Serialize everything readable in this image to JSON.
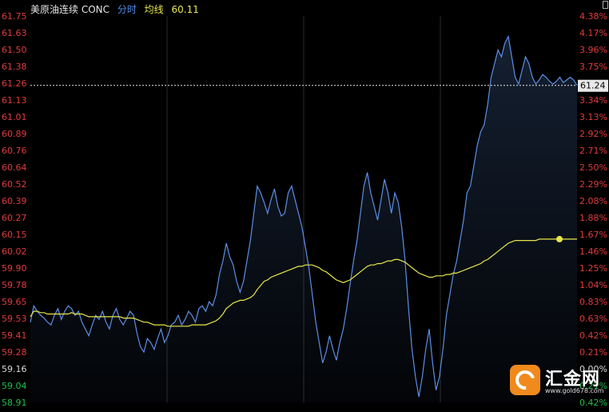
{
  "header": {
    "instrument": "美原油连续 CONC",
    "mode": "分时",
    "avg_label": "均线",
    "avg_value": "60.11"
  },
  "last_price_label": "61.24",
  "watermark": {
    "title": "汇金网",
    "subtitle": "www.gold678.com"
  },
  "colors": {
    "price_line": "#5b8fe6",
    "avg_line": "#e8e84a",
    "up": "#e23b3b",
    "down": "#1fbf4a",
    "grid": "#2a2a2a"
  },
  "chart_data": {
    "type": "line",
    "title": "",
    "xlabel": "",
    "ylabel": "",
    "ylim": [
      58.91,
      61.75
    ],
    "prev_close": 59.16,
    "y_ticks_left": [
      "61.75",
      "61.63",
      "61.50",
      "61.38",
      "61.26",
      "61.13",
      "61.01",
      "60.89",
      "60.76",
      "60.64",
      "60.52",
      "60.39",
      "60.27",
      "60.15",
      "60.02",
      "59.90",
      "59.78",
      "59.65",
      "59.53",
      "59.41",
      "59.28",
      "59.16",
      "59.04",
      "58.91"
    ],
    "y_ticks_right": [
      "4.38%",
      "4.17%",
      "3.96%",
      "3.75%",
      "3.54%",
      "3.34%",
      "3.13%",
      "2.92%",
      "2.71%",
      "2.50%",
      "2.29%",
      "2.08%",
      "1.88%",
      "1.67%",
      "1.46%",
      "1.25%",
      "1.04%",
      "0.83%",
      "0.63%",
      "0.42%",
      "0.21%",
      "0.00%",
      "0.21%",
      "0.42%"
    ],
    "reference_line": 61.24,
    "series": [
      {
        "values": [
          59.5,
          59.62,
          59.58,
          59.55,
          59.53,
          59.5,
          59.48,
          59.55,
          59.6,
          59.52,
          59.58,
          59.62,
          59.6,
          59.55,
          59.58,
          59.5,
          59.45,
          59.4,
          59.48,
          59.55,
          59.52,
          59.58,
          59.5,
          59.45,
          59.55,
          59.6,
          59.52,
          59.48,
          59.53,
          59.58,
          59.55,
          59.42,
          59.32,
          59.28,
          59.38,
          59.35,
          59.3,
          59.38,
          59.45,
          59.35,
          59.4,
          59.48,
          59.5,
          59.55,
          59.48,
          59.52,
          59.58,
          59.55,
          59.5,
          59.6,
          59.62,
          59.58,
          59.65,
          59.62,
          59.7,
          59.85,
          59.95,
          60.08,
          59.98,
          59.92,
          59.8,
          59.72,
          59.8,
          59.95,
          60.1,
          60.3,
          60.5,
          60.45,
          60.38,
          60.3,
          60.4,
          60.48,
          60.35,
          60.28,
          60.3,
          60.45,
          60.5,
          60.4,
          60.3,
          60.2,
          60.05,
          59.9,
          59.7,
          59.5,
          59.35,
          59.2,
          59.28,
          59.4,
          59.3,
          59.22,
          59.35,
          59.45,
          59.6,
          59.78,
          59.95,
          60.1,
          60.3,
          60.5,
          60.6,
          60.45,
          60.35,
          60.25,
          60.4,
          60.55,
          60.45,
          60.3,
          60.45,
          60.38,
          60.2,
          59.95,
          59.6,
          59.3,
          59.1,
          58.95,
          59.1,
          59.3,
          59.45,
          59.2,
          59.0,
          59.1,
          59.3,
          59.55,
          59.7,
          59.85,
          59.95,
          60.1,
          60.25,
          60.45,
          60.5,
          60.65,
          60.8,
          60.9,
          60.95,
          61.1,
          61.3,
          61.4,
          61.5,
          61.45,
          61.55,
          61.6,
          61.45,
          61.3,
          61.25,
          61.35,
          61.45,
          61.4,
          61.3,
          61.25,
          61.28,
          61.32,
          61.3,
          61.27,
          61.25,
          61.27,
          61.3,
          61.26,
          61.28,
          61.3,
          61.28,
          61.24
        ]
      },
      {
        "values": [
          59.54,
          59.58,
          59.58,
          59.57,
          59.57,
          59.56,
          59.56,
          59.56,
          59.56,
          59.56,
          59.56,
          59.56,
          59.57,
          59.56,
          59.56,
          59.56,
          59.55,
          59.54,
          59.54,
          59.54,
          59.54,
          59.54,
          59.54,
          59.54,
          59.54,
          59.54,
          59.54,
          59.53,
          59.53,
          59.53,
          59.53,
          59.52,
          59.51,
          59.5,
          59.5,
          59.49,
          59.48,
          59.48,
          59.48,
          59.48,
          59.47,
          59.47,
          59.47,
          59.47,
          59.47,
          59.47,
          59.47,
          59.48,
          59.48,
          59.48,
          59.48,
          59.48,
          59.49,
          59.5,
          59.51,
          59.53,
          59.56,
          59.6,
          59.62,
          59.64,
          59.65,
          59.66,
          59.66,
          59.67,
          59.68,
          59.7,
          59.74,
          59.77,
          59.8,
          59.81,
          59.83,
          59.84,
          59.85,
          59.86,
          59.87,
          59.88,
          59.89,
          59.9,
          59.91,
          59.91,
          59.92,
          59.92,
          59.92,
          59.91,
          59.9,
          59.88,
          59.87,
          59.85,
          59.83,
          59.81,
          59.8,
          59.79,
          59.8,
          59.81,
          59.83,
          59.85,
          59.87,
          59.89,
          59.91,
          59.92,
          59.92,
          59.93,
          59.93,
          59.94,
          59.95,
          59.95,
          59.96,
          59.96,
          59.95,
          59.94,
          59.92,
          59.9,
          59.88,
          59.86,
          59.85,
          59.84,
          59.83,
          59.83,
          59.84,
          59.84,
          59.84,
          59.85,
          59.85,
          59.86,
          59.86,
          59.87,
          59.88,
          59.89,
          59.9,
          59.91,
          59.92,
          59.93,
          59.95,
          59.96,
          59.98,
          60.0,
          60.02,
          60.04,
          60.06,
          60.08,
          60.09,
          60.1,
          60.1,
          60.1,
          60.1,
          60.1,
          60.1,
          60.1,
          60.11,
          60.11,
          60.11,
          60.11,
          60.11,
          60.11,
          60.11,
          60.11,
          60.11,
          60.11,
          60.11,
          60.11
        ]
      }
    ]
  }
}
